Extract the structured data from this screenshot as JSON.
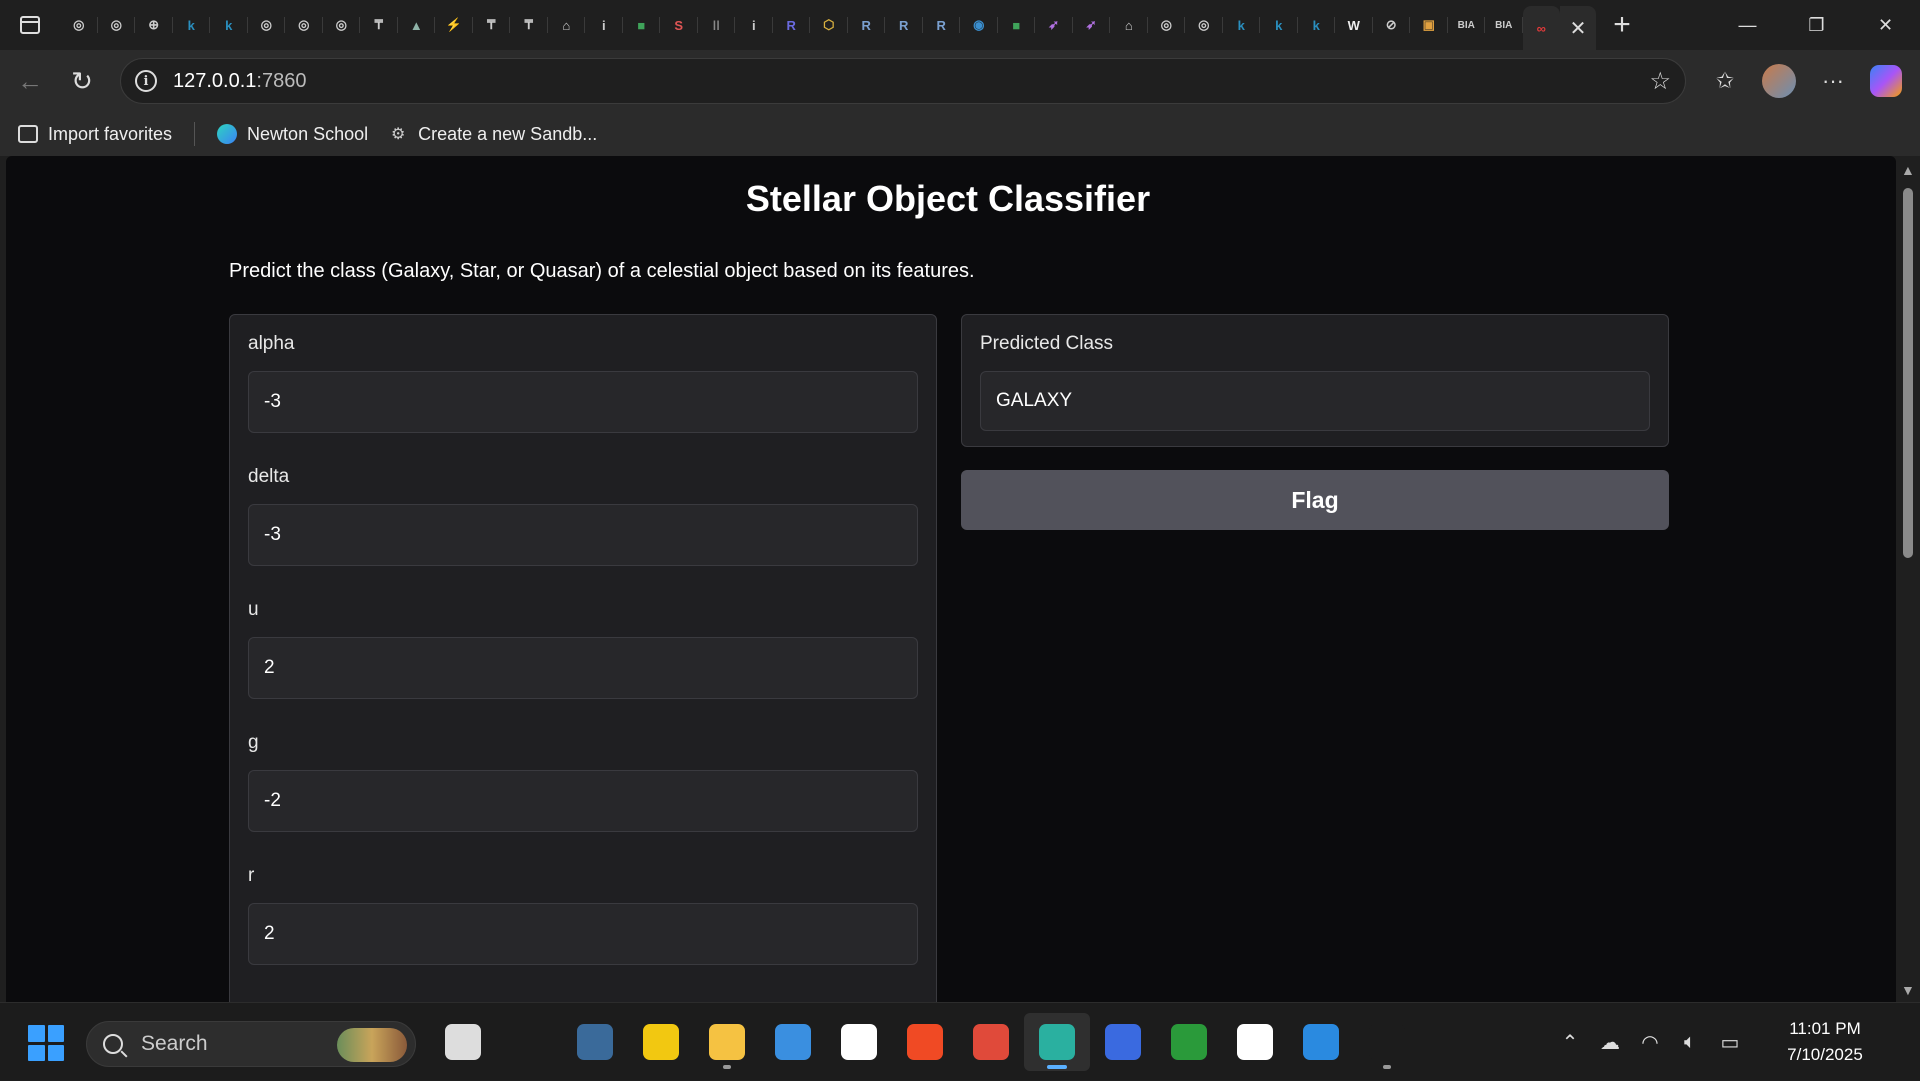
{
  "browser": {
    "tabs": [
      {
        "icon": "github-icon",
        "glyph": "◎",
        "color": "#cccccc"
      },
      {
        "icon": "github-icon",
        "glyph": "◎",
        "color": "#cccccc"
      },
      {
        "icon": "globe-icon",
        "glyph": "⊕",
        "color": "#cccccc"
      },
      {
        "icon": "k-letter-icon",
        "glyph": "k",
        "color": "#2a8fbf"
      },
      {
        "icon": "k-letter-icon",
        "glyph": "k",
        "color": "#2a8fbf"
      },
      {
        "icon": "github-icon",
        "glyph": "◎",
        "color": "#cccccc"
      },
      {
        "icon": "github-icon",
        "glyph": "◎",
        "color": "#cccccc"
      },
      {
        "icon": "github-icon",
        "glyph": "◎",
        "color": "#cccccc"
      },
      {
        "icon": "t-logo-icon",
        "glyph": "₸",
        "color": "#cccccc"
      },
      {
        "icon": "mountain-icon",
        "glyph": "▲",
        "color": "#8fb3a8"
      },
      {
        "icon": "bolt-icon",
        "glyph": "⚡",
        "color": "#e0a040"
      },
      {
        "icon": "t-logo-icon",
        "glyph": "₸",
        "color": "#cccccc"
      },
      {
        "icon": "t-logo-icon",
        "glyph": "₸",
        "color": "#cccccc"
      },
      {
        "icon": "house-icon",
        "glyph": "⌂",
        "color": "#cccccc"
      },
      {
        "icon": "info-icon",
        "glyph": "i",
        "color": "#cccccc"
      },
      {
        "icon": "green-app-icon",
        "glyph": "■",
        "color": "#3fa35a"
      },
      {
        "icon": "s-app-icon",
        "glyph": "S",
        "color": "#e05555"
      },
      {
        "icon": "bars-icon",
        "glyph": "ǀǀ",
        "color": "#888888"
      },
      {
        "icon": "info-icon",
        "glyph": "i",
        "color": "#cccccc"
      },
      {
        "icon": "r-app-icon",
        "glyph": "R",
        "color": "#6a6adf"
      },
      {
        "icon": "cube-icon",
        "glyph": "⬡",
        "color": "#d8b040"
      },
      {
        "icon": "r-letter-icon",
        "glyph": "R",
        "color": "#7aa0d0"
      },
      {
        "icon": "r-letter-icon",
        "glyph": "R",
        "color": "#7aa0d0"
      },
      {
        "icon": "r-letter-icon",
        "glyph": "R",
        "color": "#7aa0d0"
      },
      {
        "icon": "search-app-icon",
        "glyph": "◉",
        "color": "#3a8fd0"
      },
      {
        "icon": "green-app-icon",
        "glyph": "■",
        "color": "#3fa35a"
      },
      {
        "icon": "rocket-icon",
        "glyph": "➶",
        "color": "#b070e0"
      },
      {
        "icon": "rocket-icon",
        "glyph": "➶",
        "color": "#b070e0"
      },
      {
        "icon": "house-icon",
        "glyph": "⌂",
        "color": "#cccccc"
      },
      {
        "icon": "github-icon",
        "glyph": "◎",
        "color": "#cccccc"
      },
      {
        "icon": "github-icon",
        "glyph": "◎",
        "color": "#cccccc"
      },
      {
        "icon": "k-letter-icon",
        "glyph": "k",
        "color": "#2a8fbf"
      },
      {
        "icon": "k-letter-icon",
        "glyph": "k",
        "color": "#2a8fbf"
      },
      {
        "icon": "k-letter-icon",
        "glyph": "k",
        "color": "#2a8fbf"
      },
      {
        "icon": "w-app-icon",
        "glyph": "W",
        "color": "#eeeeee"
      },
      {
        "icon": "no-entry-icon",
        "glyph": "⊘",
        "color": "#cccccc"
      },
      {
        "icon": "colorful-app-icon",
        "glyph": "▣",
        "color": "#e0a040"
      },
      {
        "icon": "bia-app-icon",
        "glyph": "BIA",
        "color": "#cccccc"
      },
      {
        "icon": "bia-app-icon",
        "glyph": "BIA",
        "color": "#cccccc"
      },
      {
        "icon": "infinity-icon",
        "glyph": "∞",
        "color": "#e03a3a"
      }
    ],
    "url": {
      "host": "127.0.0.1",
      "port": ":7860"
    },
    "favorites": [
      {
        "label": "Import favorites",
        "icon": "import-favorites-icon"
      },
      {
        "label": "Newton School",
        "icon": "newton-school-icon"
      },
      {
        "label": "Create a new Sandb...",
        "icon": "sandbox-icon"
      }
    ]
  },
  "app": {
    "title": "Stellar Object Classifier",
    "description": "Predict the class (Galaxy, Star, or Quasar) of a celestial object based on its features.",
    "fields": [
      {
        "label": "alpha",
        "value": "-3"
      },
      {
        "label": "delta",
        "value": "-3"
      },
      {
        "label": "u",
        "value": "2"
      },
      {
        "label": "g",
        "value": "-2"
      },
      {
        "label": "r",
        "value": "2"
      }
    ],
    "output_label": "Predicted Class",
    "output_value": "GALAXY",
    "flag_label": "Flag"
  },
  "taskbar": {
    "search_placeholder": "Search",
    "apps": [
      {
        "icon": "task-view-icon",
        "color": "#dddddd"
      },
      {
        "icon": "no-entry-app-icon",
        "color": "#1c1c1c"
      },
      {
        "icon": "mysql-icon",
        "color": "#3a6a9a"
      },
      {
        "icon": "power-bi-icon",
        "color": "#f2c811"
      },
      {
        "icon": "file-explorer-icon",
        "color": "#f5c242"
      },
      {
        "icon": "notepad-icon",
        "color": "#3a8fe0"
      },
      {
        "icon": "chatgpt-icon",
        "color": "#ffffff"
      },
      {
        "icon": "brave-icon",
        "color": "#f04a24"
      },
      {
        "icon": "chrome-icon",
        "color": "#e04a3a"
      },
      {
        "icon": "edge-icon",
        "color": "#2ab0a0"
      },
      {
        "icon": "w-app-icon",
        "color": "#3a6ae0"
      },
      {
        "icon": "ring-app-icon",
        "color": "#2a9a3a"
      },
      {
        "icon": "notion-icon",
        "color": "#ffffff"
      },
      {
        "icon": "vscode-icon",
        "color": "#2a8ae0"
      },
      {
        "icon": "box-app-icon",
        "color": "#1c1c1c"
      },
      {
        "icon": "jupyter-icon",
        "color": "#1c1c1c"
      }
    ],
    "time": "11:01 PM",
    "date": "7/10/2025"
  }
}
